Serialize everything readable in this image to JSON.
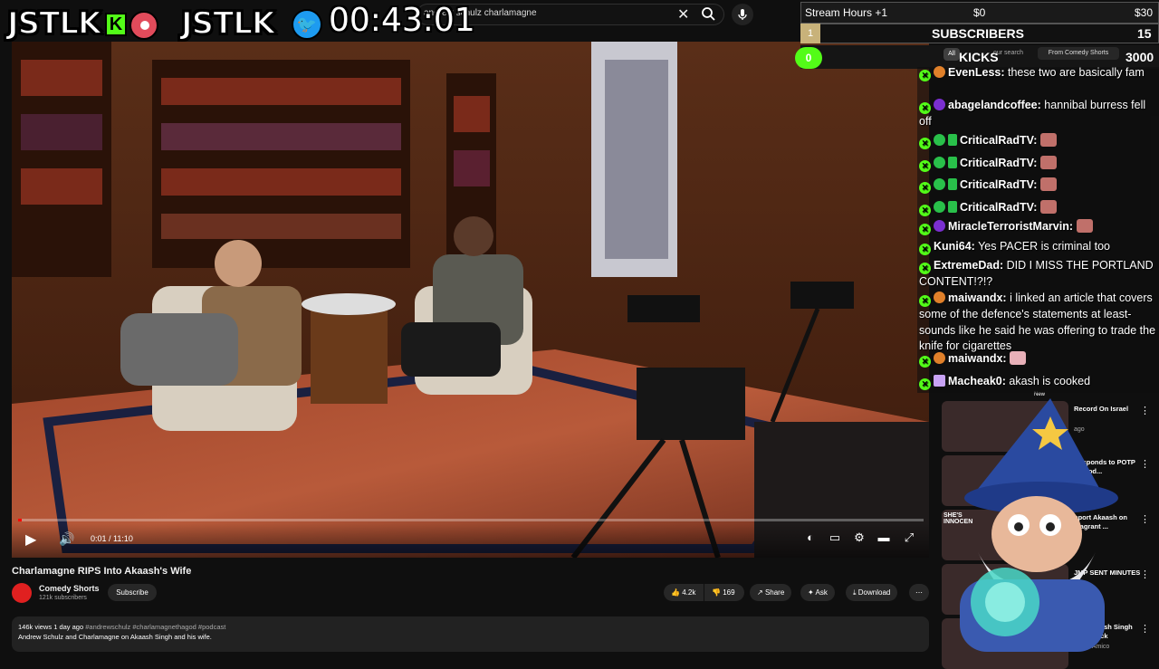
{
  "search": {
    "query": "andrew schulz charlamagne"
  },
  "overlay": {
    "logo_left": "JSTLK",
    "kick_badge": "K",
    "logo_right": "JSTLK",
    "timer": "00:43:01"
  },
  "stats": {
    "stream_hours": "Stream Hours +1",
    "goal_min": "$0",
    "goal_max": "$30",
    "rank": "1",
    "subs_label": "SUBSCRIBERS",
    "subs_count": "15",
    "kick_progress": "0",
    "kicks_label": "KICKS",
    "kicks_count": "3000",
    "chip_all": "All",
    "chip_search": "our search",
    "chip_from": "From Comedy Shorts"
  },
  "chat": [
    {
      "user": "EvenLess:",
      "text": " these two are basically fam"
    },
    {
      "user": "abagelandcoffee:",
      "text": " hannibal burress fell off"
    },
    {
      "user": "CriticalRadTV:",
      "text": ""
    },
    {
      "user": "CriticalRadTV:",
      "text": ""
    },
    {
      "user": "CriticalRadTV:",
      "text": ""
    },
    {
      "user": "CriticalRadTV:",
      "text": ""
    },
    {
      "user": "MiracleTerroristMarvin:",
      "text": ""
    },
    {
      "user": "Kuni64:",
      "text": " Yes PACER is criminal too"
    },
    {
      "user": "ExtremeDad:",
      "text": " DID I MISS THE PORTLAND CONTENT!?!?"
    },
    {
      "user": "maiwandx:",
      "text": " i linked an article that covers some of the defence's statements at least- sounds like he said he was offering to trade the knife for cigarettes"
    },
    {
      "user": "maiwandx:",
      "text": ""
    },
    {
      "user": "Macheak0:",
      "text": " akash is cooked"
    }
  ],
  "player": {
    "time": "0:01 / 11:10",
    "progress": 0.0015
  },
  "video": {
    "title": "Charlamagne RIPS Into Akaash's Wife",
    "channel": "Comedy Shorts",
    "subscribers": "121k subscribers",
    "subscribe_label": "Subscribe",
    "likes": "4.2k",
    "dislikes": "169",
    "share_label": "Share",
    "ask_label": "Ask",
    "download_label": "Download",
    "views": "146k views",
    "age": "1 day ago",
    "tags": "#andrewschulz #charlamagnethagod #podcast",
    "description": "Andrew Schulz and Charlamagne on Akaash Singh and his wife."
  },
  "recommendations": [
    {
      "title": "Record On Israel",
      "meta": "ago"
    },
    {
      "title": "Responds to POTP Episod...",
      "meta": ""
    },
    {
      "title": "pport Akaash on Flagrant ...",
      "meta": ""
    },
    {
      "title": "JMP SENT MINUTES",
      "meta": ""
    },
    {
      "title": "s to Akaash Singh Diss Track",
      "meta": "Crack Amico"
    }
  ],
  "recommendations_labels": {
    "new_badge": "New",
    "thumb_text": "SHE'S INNOCEN"
  },
  "colors": {
    "kick_green": "#53fc18",
    "youtube_red": "#ff0000",
    "background": "#0f0f0f"
  }
}
